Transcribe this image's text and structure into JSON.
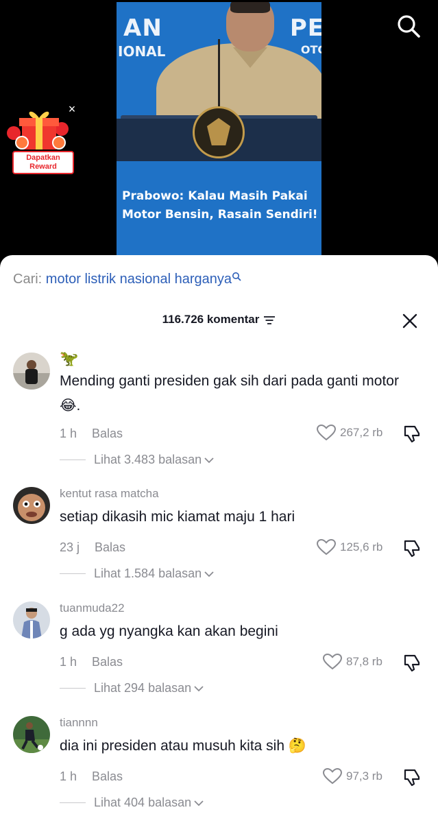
{
  "video": {
    "caption": "Prabowo: Kalau Masih Pakai Motor Bensin, Rasain Sendiri!",
    "bg_text_left_1": "AN",
    "bg_text_left_2": "IONAL",
    "bg_text_right_1": "PE",
    "bg_text_right_2": "OTO"
  },
  "reward": {
    "label": "Dapatkan Reward",
    "close": "×"
  },
  "search": {
    "prefix": "Cari:",
    "query": "motor listrik nasional harganya"
  },
  "comments_header": {
    "count_label": "116.726 komentar"
  },
  "comments": [
    {
      "user": "🦖",
      "text": "Mending ganti presiden gak sih dari pada ganti motor 😂.",
      "time": "1 h",
      "reply_label": "Balas",
      "likes": "267,2 rb",
      "view_replies": "Lihat 3.483 balasan"
    },
    {
      "user": "kentut rasa matcha",
      "text": "setiap dikasih mic kiamat maju 1 hari",
      "time": "23 j",
      "reply_label": "Balas",
      "likes": "125,6 rb",
      "view_replies": "Lihat 1.584 balasan"
    },
    {
      "user": "tuanmuda22",
      "text": "g ada yg nyangka kan akan begini",
      "time": "1 h",
      "reply_label": "Balas",
      "likes": "87,8 rb",
      "view_replies": "Lihat 294 balasan"
    },
    {
      "user": "tiannnn",
      "text": "dia ini presiden atau musuh kita sih 🤔",
      "time": "1 h",
      "reply_label": "Balas",
      "likes": "97,3 rb",
      "view_replies": "Lihat 404 balasan"
    }
  ],
  "colors": {
    "accent_link": "#2d5fb8",
    "muted": "#8a8b91",
    "video_bg": "#1f72c6",
    "reward_red": "#e8262c"
  }
}
